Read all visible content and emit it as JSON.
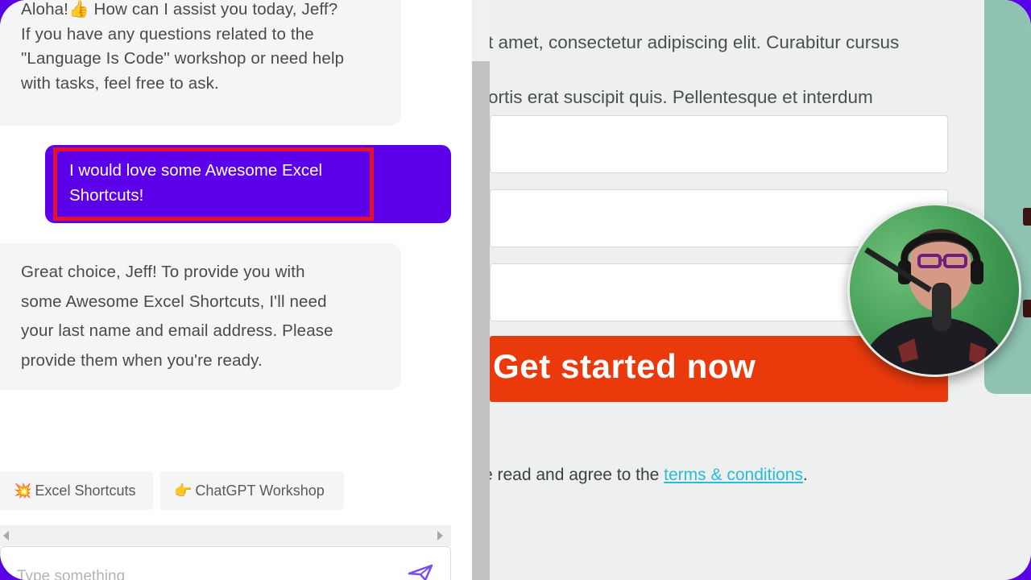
{
  "chat": {
    "messages": [
      {
        "role": "bot",
        "lines": [
          "Aloha!👍 How can I assist you today, Jeff?",
          "If you have any questions related to the",
          "\"Language Is Code\" workshop or need help",
          "with tasks, feel free to ask."
        ]
      },
      {
        "role": "user",
        "text": "I would love some Awesome Excel Shortcuts!"
      },
      {
        "role": "bot",
        "lines": [
          "Great choice, Jeff! To provide you with",
          "some Awesome Excel Shortcuts, I'll need",
          "your last name and email address. Please",
          "provide them when you're ready."
        ]
      }
    ],
    "quick_replies": [
      {
        "emoji": "💥",
        "label": "Excel Shortcuts"
      },
      {
        "emoji": "👉",
        "label": "ChatGPT Workshop"
      }
    ],
    "input_placeholder": "Type something"
  },
  "webpage": {
    "paragraph_lines": [
      "t amet, consectetur adipiscing elit. Curabitur cursus",
      "ortis erat suscipit quis. Pellentesque et interdum"
    ],
    "cta_label": "Get started now",
    "terms_prefix": "e read and agree to the ",
    "terms_link": "terms & conditions",
    "terms_suffix": "."
  },
  "colors": {
    "user_bubble": "#5b00e8",
    "highlight": "#e5102a",
    "cta": "#ea3a0c",
    "link": "#2bbbd6",
    "frame": "#5a00e6"
  }
}
